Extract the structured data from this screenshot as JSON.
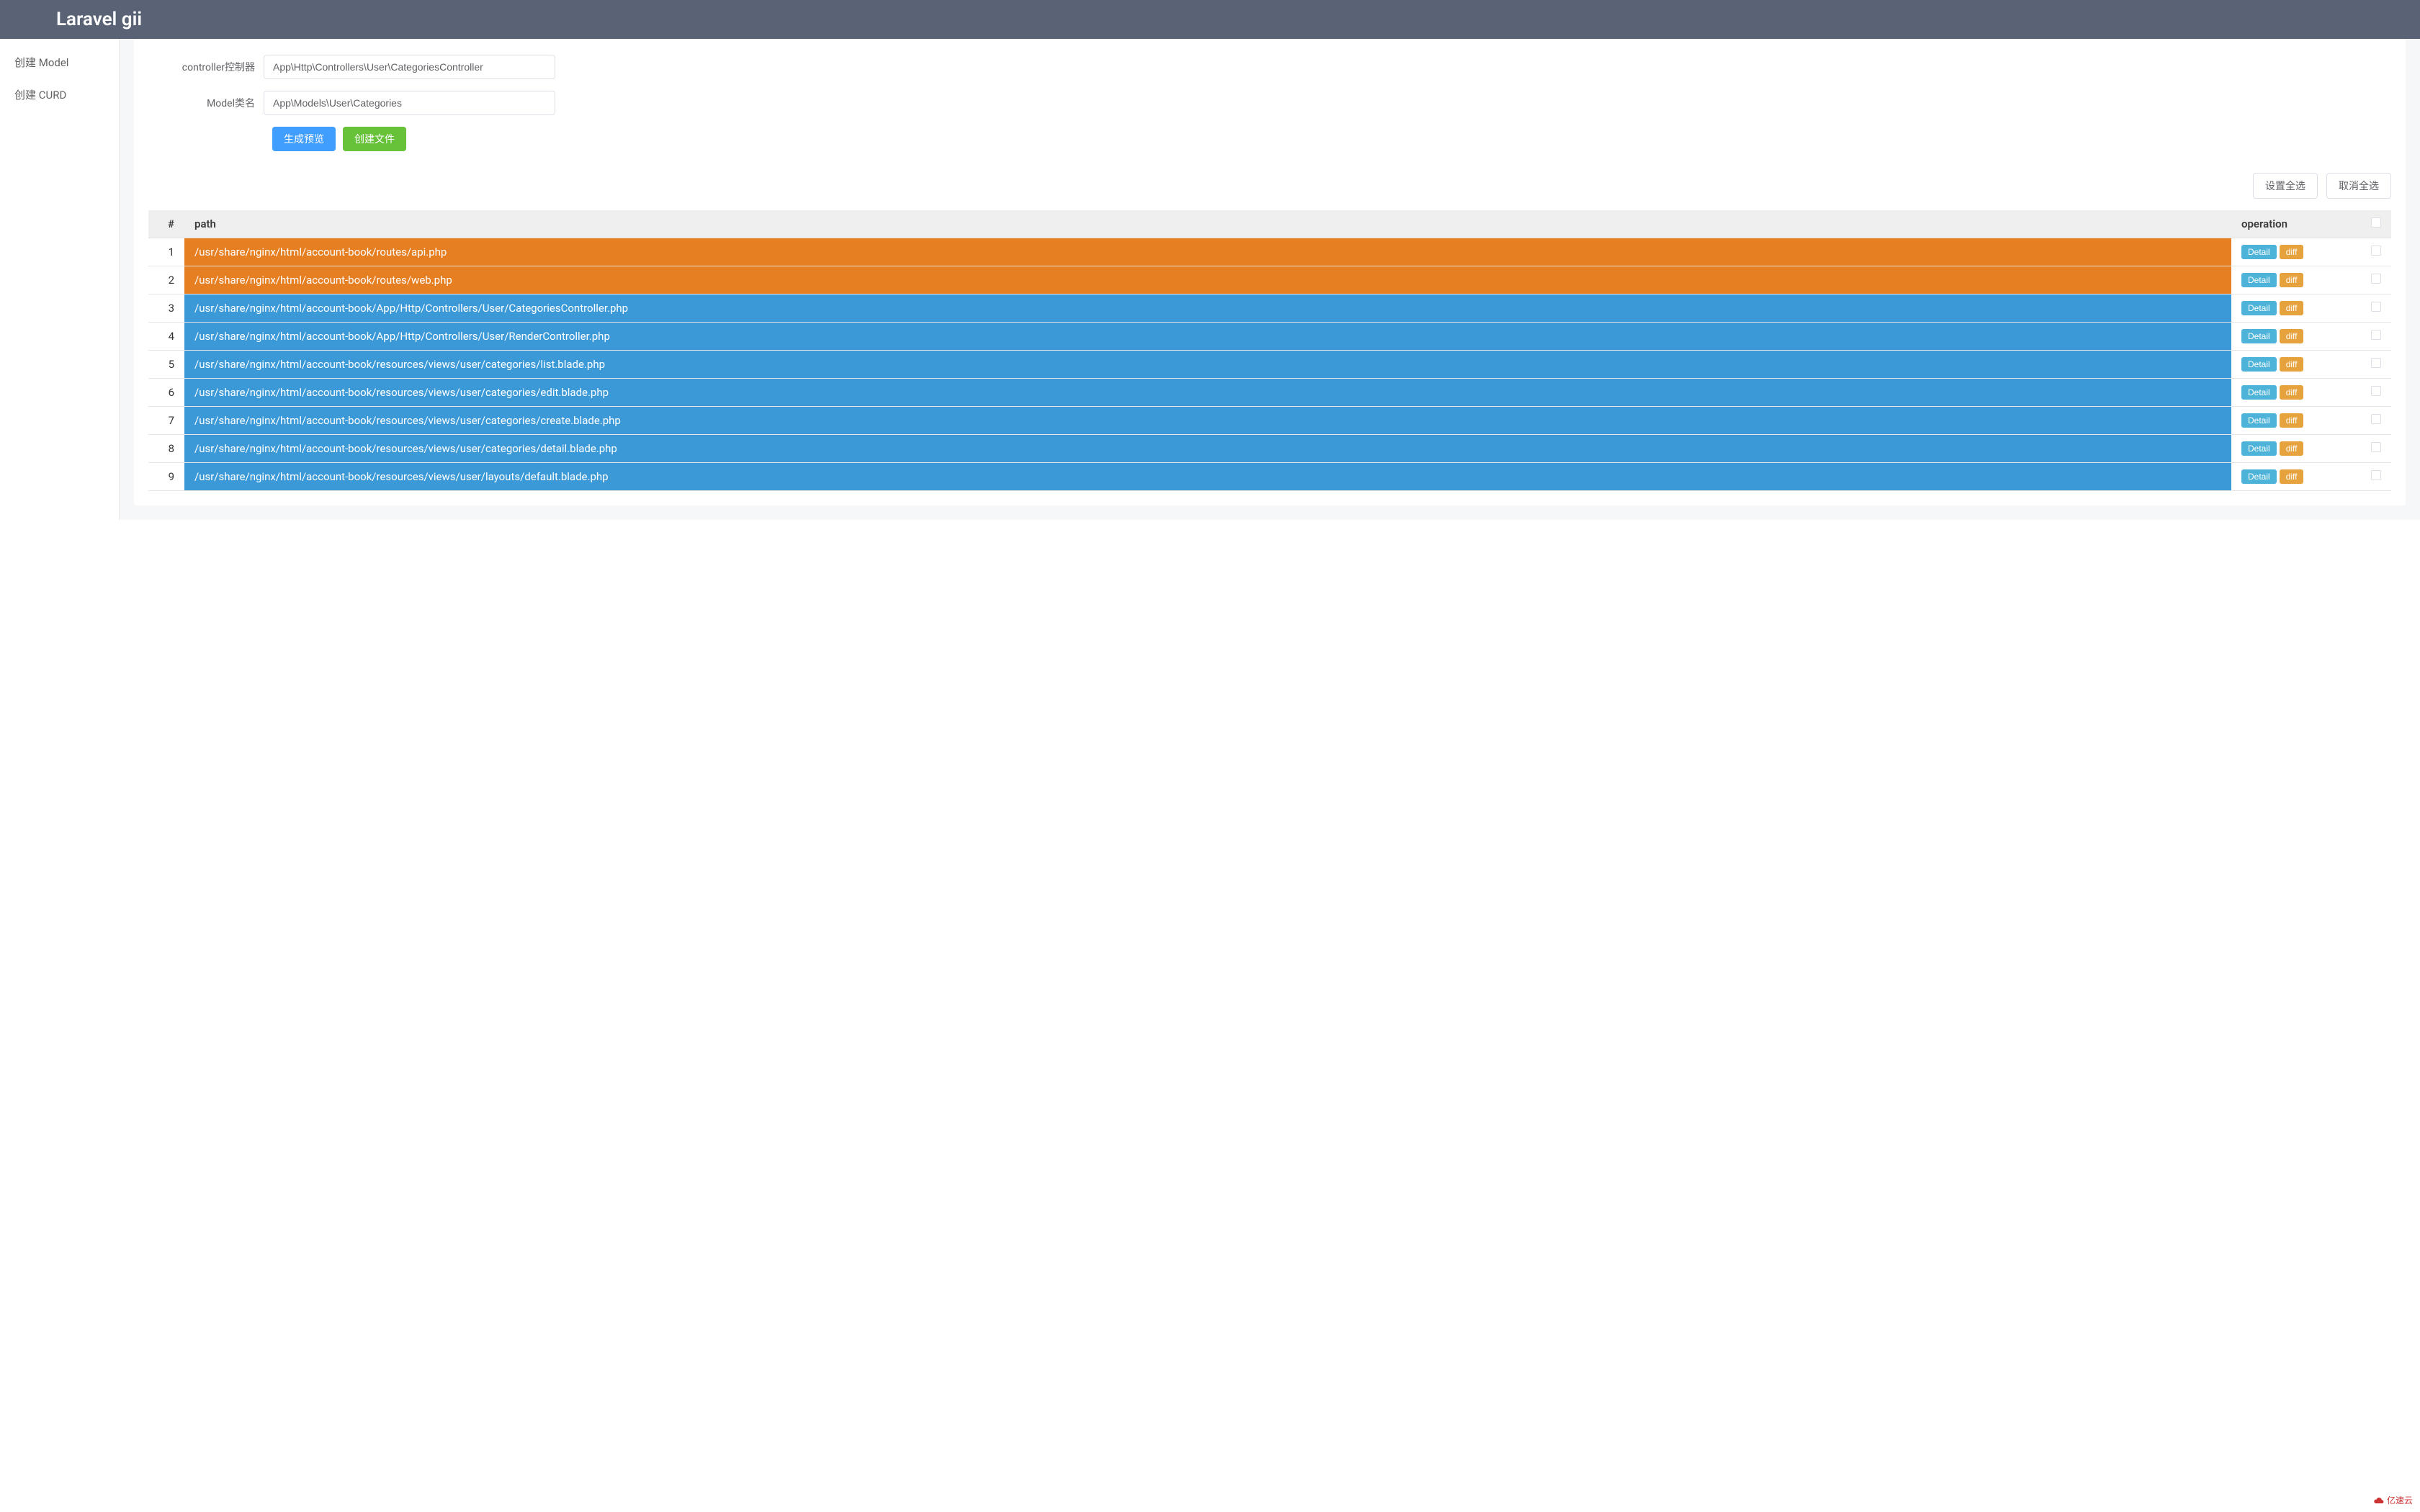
{
  "header": {
    "title": "Laravel gii"
  },
  "sidebar": {
    "items": [
      {
        "label": "创建 Model"
      },
      {
        "label": "创建 CURD"
      }
    ]
  },
  "form": {
    "controller_label": "controller控制器",
    "controller_value": "App\\Http\\Controllers\\User\\CategoriesController",
    "model_label": "Model类名",
    "model_value": "App\\Models\\User\\Categories",
    "preview_btn": "生成预览",
    "create_btn": "创建文件"
  },
  "top_actions": {
    "select_all": "设置全选",
    "deselect_all": "取消全选"
  },
  "table": {
    "headers": {
      "num": "#",
      "path": "path",
      "operation": "operation"
    },
    "detail_label": "Detail",
    "diff_label": "diff",
    "rows": [
      {
        "num": "1",
        "path": "/usr/share/nginx/html/account-book/routes/api.php",
        "color": "orange"
      },
      {
        "num": "2",
        "path": "/usr/share/nginx/html/account-book/routes/web.php",
        "color": "orange"
      },
      {
        "num": "3",
        "path": "/usr/share/nginx/html/account-book/App/Http/Controllers/User/CategoriesController.php",
        "color": "blue"
      },
      {
        "num": "4",
        "path": "/usr/share/nginx/html/account-book/App/Http/Controllers/User/RenderController.php",
        "color": "blue"
      },
      {
        "num": "5",
        "path": "/usr/share/nginx/html/account-book/resources/views/user/categories/list.blade.php",
        "color": "blue"
      },
      {
        "num": "6",
        "path": "/usr/share/nginx/html/account-book/resources/views/user/categories/edit.blade.php",
        "color": "blue"
      },
      {
        "num": "7",
        "path": "/usr/share/nginx/html/account-book/resources/views/user/categories/create.blade.php",
        "color": "blue"
      },
      {
        "num": "8",
        "path": "/usr/share/nginx/html/account-book/resources/views/user/categories/detail.blade.php",
        "color": "blue"
      },
      {
        "num": "9",
        "path": "/usr/share/nginx/html/account-book/resources/views/user/layouts/default.blade.php",
        "color": "blue"
      }
    ]
  },
  "watermark": {
    "text": "亿速云"
  }
}
